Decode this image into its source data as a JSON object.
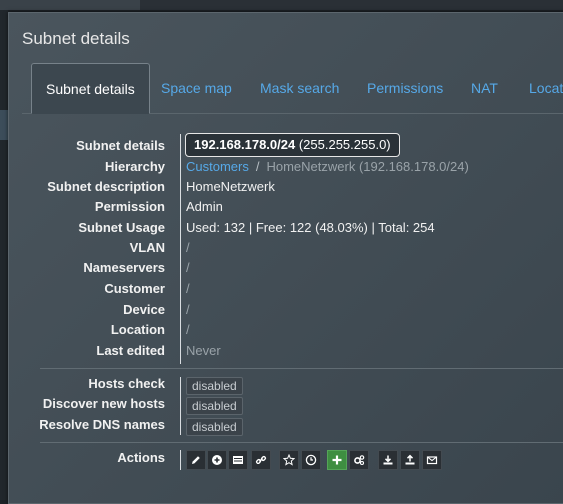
{
  "panel": {
    "title": "Subnet details"
  },
  "tabs": [
    {
      "label": "Subnet details"
    },
    {
      "label": "Space map"
    },
    {
      "label": "Mask search"
    },
    {
      "label": "Permissions"
    },
    {
      "label": "NAT"
    },
    {
      "label": "Locati"
    }
  ],
  "details": {
    "subnet_label": "Subnet details",
    "subnet_cidr": "192.168.178.0/24",
    "subnet_mask": "(255.255.255.0)",
    "hierarchy_label": "Hierarchy",
    "hierarchy_root": "Customers",
    "hierarchy_sep": "/",
    "hierarchy_leaf": "HomeNetzwerk (192.168.178.0/24)",
    "description_label": "Subnet description",
    "description_value": "HomeNetzwerk",
    "permission_label": "Permission",
    "permission_value": "Admin",
    "usage_label": "Subnet Usage",
    "usage_value": "Used: 132 | Free: 122 (48.03%) | Total: 254",
    "vlan_label": "VLAN",
    "vlan_value": "/",
    "nameservers_label": "Nameservers",
    "nameservers_value": "/",
    "customer_label": "Customer",
    "customer_value": "/",
    "device_label": "Device",
    "device_value": "/",
    "location_label": "Location",
    "location_value": "/",
    "last_edited_label": "Last edited",
    "last_edited_value": "Never"
  },
  "checks": {
    "hosts_check_label": "Hosts check",
    "hosts_check_value": "disabled",
    "discover_label": "Discover new hosts",
    "discover_value": "disabled",
    "resolve_dns_label": "Resolve DNS names",
    "resolve_dns_value": "disabled"
  },
  "actions": {
    "label": "Actions",
    "icons": [
      "pencil-icon",
      "plus-circle-icon",
      "list-icon",
      "link-icon",
      "star-icon",
      "clock-icon",
      "plus-icon",
      "cogs-icon",
      "download-icon",
      "upload-icon",
      "envelope-icon"
    ]
  },
  "colors": {
    "link": "#56a9e8",
    "panel": "#434e56",
    "green": "#3e8e41"
  }
}
